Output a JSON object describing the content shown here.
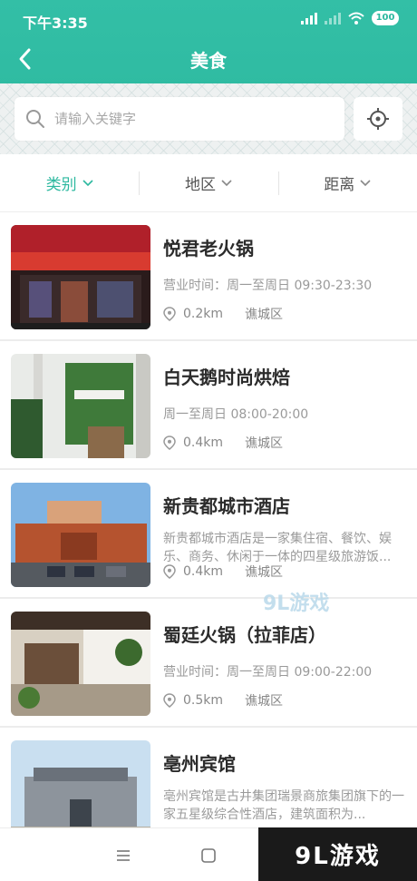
{
  "status": {
    "time": "下午3:35",
    "battery": "100"
  },
  "nav": {
    "title": "美食"
  },
  "search": {
    "placeholder": "请输入关键字"
  },
  "filters": [
    {
      "label": "类别",
      "active": true
    },
    {
      "label": "地区",
      "active": false
    },
    {
      "label": "距离",
      "active": false
    }
  ],
  "items": [
    {
      "title": "悦君老火锅",
      "info": "营业时间：周一至周日 09:30-23:30",
      "distance": "0.2km",
      "district": "谯城区"
    },
    {
      "title": "白天鹅时尚烘焙",
      "info": "周一至周日 08:00-20:00",
      "distance": "0.4km",
      "district": "谯城区"
    },
    {
      "title": "新贵都城市酒店",
      "desc": "新贵都城市酒店是一家集住宿、餐饮、娱乐、商务、休闲于一体的四星级旅游饭...",
      "distance": "0.4km",
      "district": "谯城区"
    },
    {
      "title": "蜀廷火锅（拉菲店）",
      "info": "营业时间：周一至周日 09:00-22:00",
      "distance": "0.5km",
      "district": "谯城区"
    },
    {
      "title": "亳州宾馆",
      "desc": "亳州宾馆是古井集团瑞景商旅集团旗下的一家五星级综合性酒店，建筑面积为..."
    }
  ],
  "watermark": {
    "logo_text": "9L游戏",
    "mid_text": "9L游戏"
  },
  "colors": {
    "accent": "#2cb89f"
  }
}
